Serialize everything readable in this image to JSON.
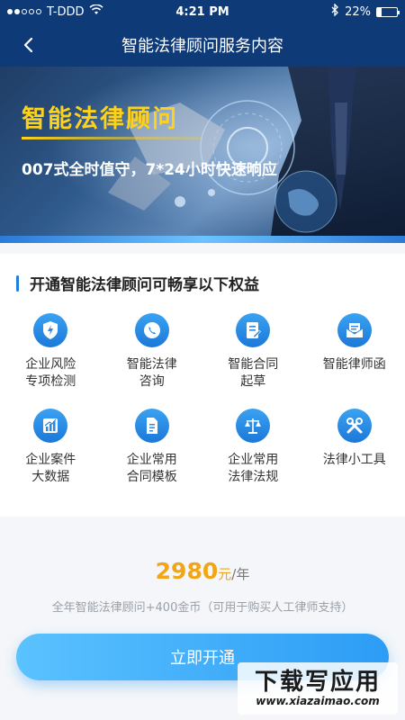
{
  "status_bar": {
    "carrier": "T-DDD",
    "time": "4:21 PM",
    "battery_percent": "22%",
    "battery_level": 0.22,
    "signal_dots": 5,
    "signal_filled": 2
  },
  "nav": {
    "title": "智能法律顾问服务内容",
    "back_icon": "chevron-left-icon"
  },
  "banner": {
    "title": "智能法律顾问",
    "subtitle": "007式全时值守，7*24小时快速响应"
  },
  "benefits": {
    "title": "开通智能法律顾问可畅享以下权益",
    "items": [
      {
        "label": "企业风险\n专项检测",
        "icon": "shield-bolt-icon"
      },
      {
        "label": "智能法律\n咨询",
        "icon": "phone-chat-icon"
      },
      {
        "label": "智能合同\n起草",
        "icon": "edit-document-icon"
      },
      {
        "label": "智能律师函",
        "icon": "letter-icon"
      },
      {
        "label": "企业案件\n大数据",
        "icon": "bar-chart-icon"
      },
      {
        "label": "企业常用\n合同模板",
        "icon": "document-icon"
      },
      {
        "label": "企业常用\n法律法规",
        "icon": "scales-icon"
      },
      {
        "label": "法律小工具",
        "icon": "tools-icon"
      }
    ]
  },
  "price": {
    "amount": "2980",
    "unit": "元",
    "period": "/年",
    "note": "全年智能法律顾问+400金币（可用于购买人工律师支持）"
  },
  "cta": {
    "label": "立即开通"
  },
  "watermark": {
    "main": "下载写应用",
    "url": "www.xiazaimao.com"
  },
  "colors": {
    "header": "#0f3a78",
    "accent": "#1e7fe0",
    "price": "#f2a516",
    "banner_title": "#ffd21a"
  }
}
